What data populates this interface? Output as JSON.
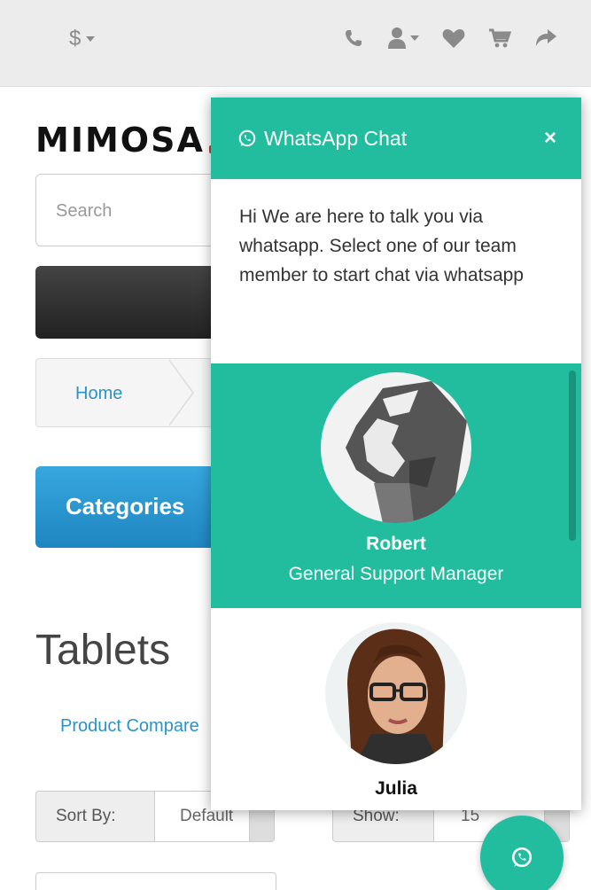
{
  "topbar": {
    "currency_symbol": "$",
    "icons": [
      "phone-icon",
      "user-icon",
      "heart-icon",
      "cart-icon",
      "share-icon"
    ]
  },
  "page": {
    "logo_text": "MIMOSA",
    "search_placeholder": "Search",
    "breadcrumb_home": "Home",
    "categories_label": "Categories",
    "title": "Tablets",
    "product_compare_link": "Product Compare",
    "sort_by_label": "Sort By:",
    "sort_by_value": "Default",
    "show_label": "Show:",
    "show_value": "15"
  },
  "whatsapp": {
    "header_title": "WhatsApp Chat",
    "close_symbol": "×",
    "intro_text": "Hi We are here to talk you via whatsapp. Select one of our team member to start chat via whatsapp",
    "members": [
      {
        "name": "Robert",
        "role": "General Support Manager",
        "active": true
      },
      {
        "name": "Julia",
        "role": "",
        "active": false
      }
    ]
  },
  "colors": {
    "whatsapp_green": "#21bd9e",
    "categories_blue": "#2a93c9",
    "topbar_bg": "#ececec"
  }
}
